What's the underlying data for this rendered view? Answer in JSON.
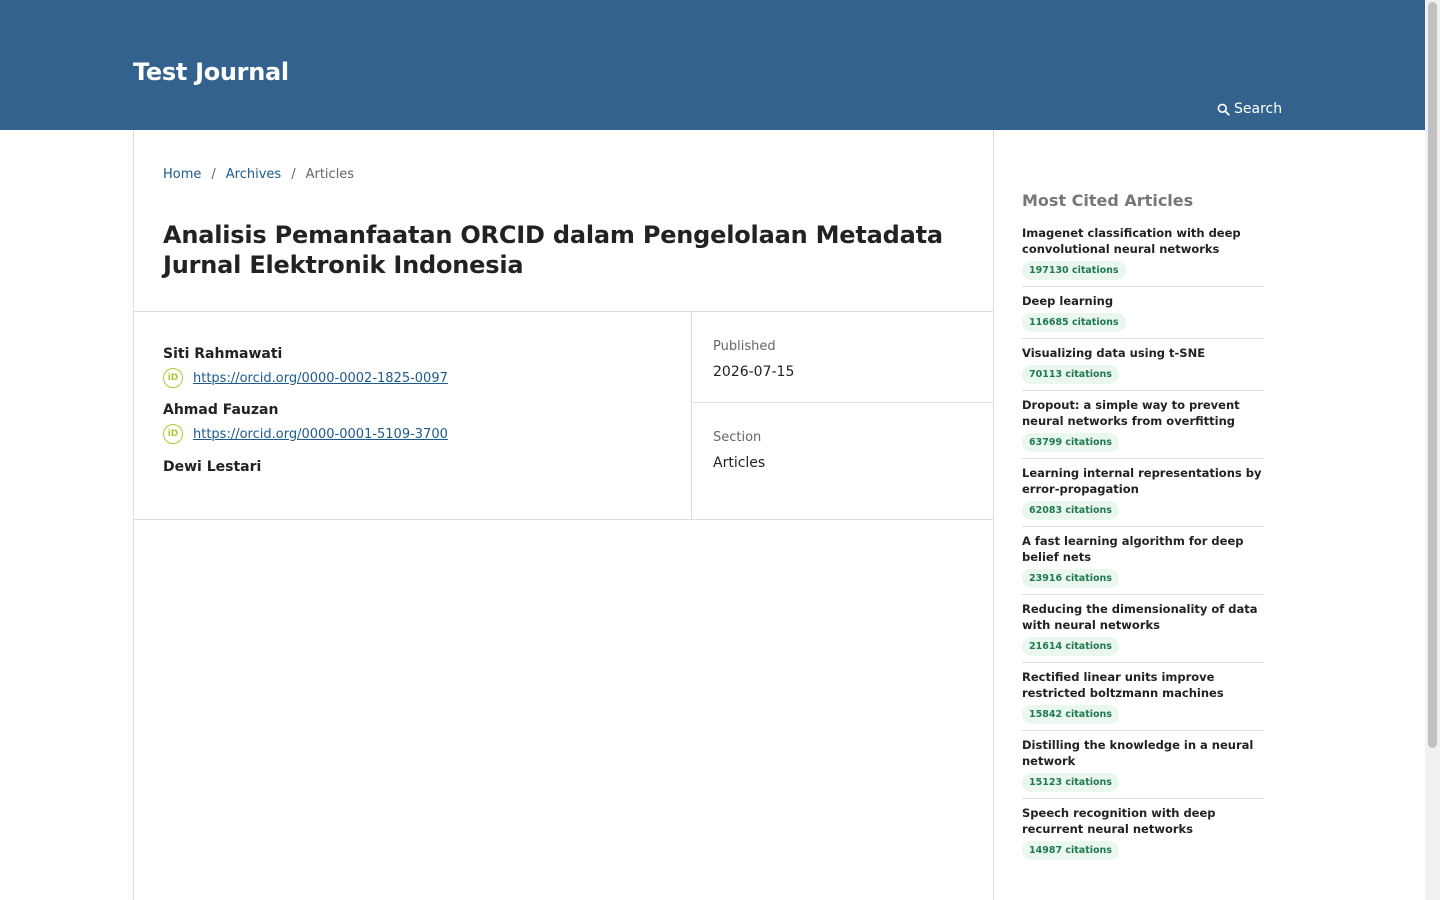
{
  "header": {
    "journal_title": "Test Journal",
    "search_label": "Search"
  },
  "breadcrumb": {
    "home": "Home",
    "archives": "Archives",
    "current": "Articles",
    "separator": "/"
  },
  "article": {
    "title": "Analisis Pemanfaatan ORCID dalam Pengelolaan Metadata Jurnal Elektronik Indonesia",
    "authors": [
      {
        "name": "Siti Rahmawati",
        "orcid": "https://orcid.org/0000-0002-1825-0097"
      },
      {
        "name": "Ahmad Fauzan",
        "orcid": "https://orcid.org/0000-0001-5109-3700"
      },
      {
        "name": "Dewi Lestari"
      }
    ],
    "orcid_icon_text": "iD",
    "published_label": "Published",
    "published_value": "2026-07-15",
    "section_label": "Section",
    "section_value": "Articles"
  },
  "sidebar": {
    "title": "Most Cited Articles",
    "items": [
      {
        "title": "Imagenet classification with deep convolutional neural networks",
        "citations": "197130 citations"
      },
      {
        "title": "Deep learning",
        "citations": "116685 citations"
      },
      {
        "title": "Visualizing data using t-SNE",
        "citations": "70113 citations"
      },
      {
        "title": "Dropout: a simple way to prevent neural networks from overfitting",
        "citations": "63799 citations"
      },
      {
        "title": "Learning internal representations by error-propagation",
        "citations": "62083 citations"
      },
      {
        "title": "A fast learning algorithm for deep belief nets",
        "citations": "23916 citations"
      },
      {
        "title": "Reducing the dimensionality of data with neural networks",
        "citations": "21614 citations"
      },
      {
        "title": "Rectified linear units improve restricted boltzmann machines",
        "citations": "15842 citations"
      },
      {
        "title": "Distilling the knowledge in a neural network",
        "citations": "15123 citations"
      },
      {
        "title": "Speech recognition with deep recurrent neural networks",
        "citations": "14987 citations"
      }
    ]
  },
  "colors": {
    "header_bg": "#32628d",
    "link": "#1e5a8c",
    "orcid_green": "#a6ce39",
    "badge_bg": "#eaf7ef",
    "badge_text": "#1f7a4c"
  }
}
